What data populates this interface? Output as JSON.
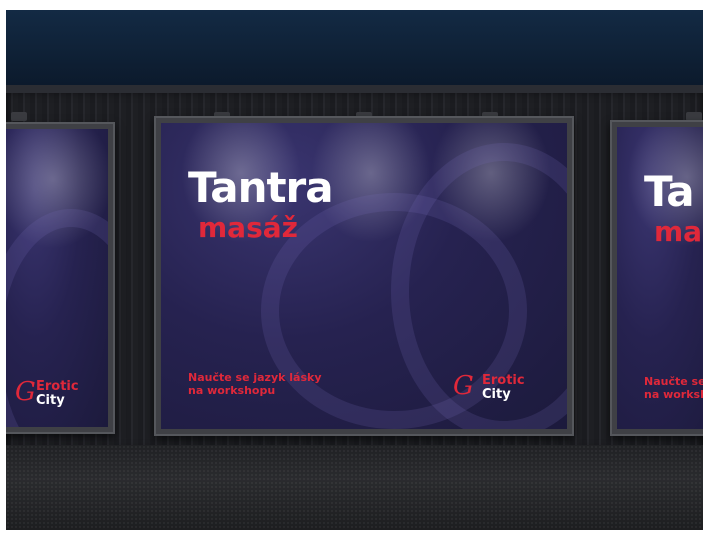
{
  "poster": {
    "title": "Tantra",
    "subtitle": "masáž",
    "tagline_line1": "Naučte se jazyk lásky",
    "tagline_line2": "na workshopu",
    "logo_word1": "Erotic",
    "logo_word2": "City",
    "logo_mark": "G"
  },
  "right_poster": {
    "title": "Ta",
    "subtitle": "ma",
    "tagline_line1": "Naučte se",
    "tagline_line2": "na worksh"
  },
  "colors": {
    "accent": "#e0283a",
    "poster_bg": "#262250"
  }
}
